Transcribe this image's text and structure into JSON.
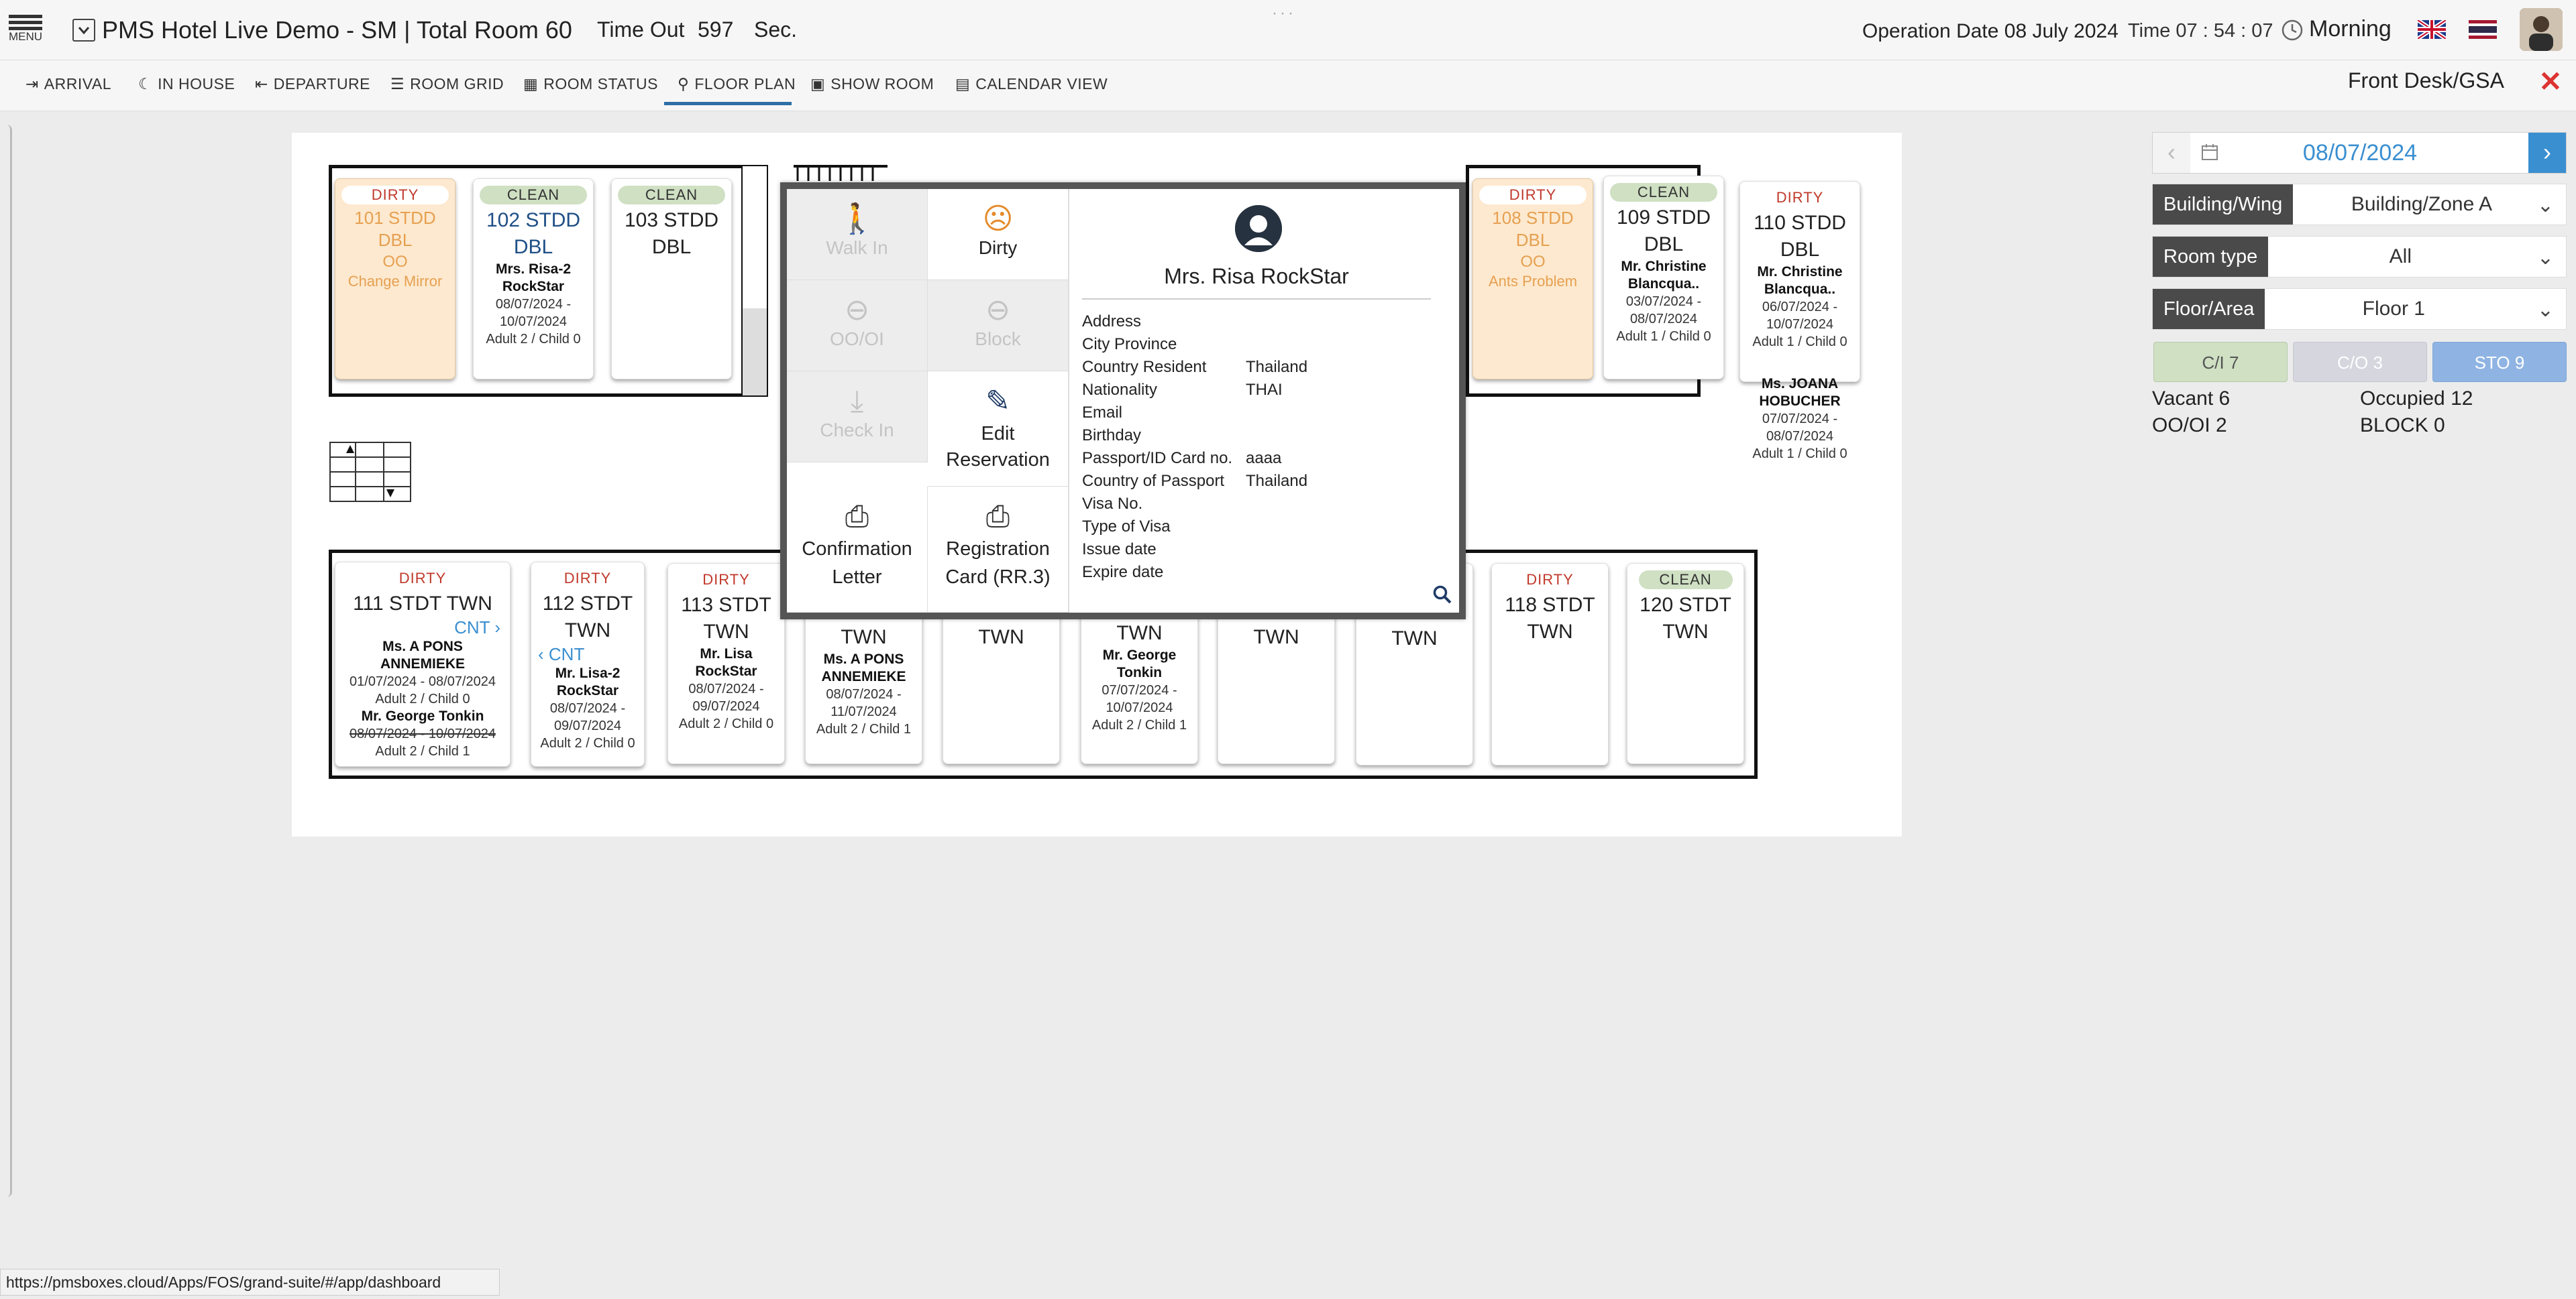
{
  "header": {
    "menu_label": "MENU",
    "hotel_title": "PMS Hotel Live Demo - SM | Total Room 60",
    "timeout_label": "Time Out",
    "timeout_value": "597",
    "timeout_unit": "Sec.",
    "operation_date": "Operation Date 08 July 2024",
    "time_label": "Time 07 : 54 : 07",
    "shift": "Morning"
  },
  "nav": {
    "items": [
      "ARRIVAL",
      "IN HOUSE",
      "DEPARTURE",
      "ROOM GRID",
      "ROOM STATUS",
      "FLOOR PLAN",
      "SHOW ROOM",
      "CALENDAR VIEW"
    ],
    "active": "FLOOR PLAN",
    "role": "Front Desk/GSA"
  },
  "rooms_top": [
    {
      "status": "DIRTY",
      "name": "101 STDD",
      "type": "DBL",
      "oo": "OO",
      "note": "Change Mirror"
    },
    {
      "status": "CLEAN",
      "name": "102 STDD",
      "type": "DBL",
      "guest1": "Mrs. Risa-2",
      "guest2": "RockStar",
      "dates1": "08/07/2024 -",
      "dates2": "10/07/2024",
      "pax": "Adult 2 / Child 0"
    },
    {
      "status": "CLEAN",
      "name": "103 STDD",
      "type": "DBL"
    },
    {
      "status": "DIRTY",
      "name": "108 STDD",
      "type": "DBL",
      "oo": "OO",
      "note": "Ants Problem"
    },
    {
      "status": "CLEAN",
      "name": "109 STDD",
      "type": "DBL",
      "guest1": "Mr. Christine",
      "guest2": "Blancqua..",
      "dates1": "03/07/2024 -",
      "dates2": "08/07/2024",
      "pax": "Adult 1 / Child 0"
    },
    {
      "status": "DIRTY",
      "name": "110 STDD",
      "type": "DBL",
      "guest1": "Mr. Christine",
      "guest2": "Blancqua..",
      "dates1": "06/07/2024 -",
      "dates2": "10/07/2024",
      "pax": "Adult 1 / Child 0",
      "guest3": "Ms. JOANA",
      "guest4": "HOBUCHER",
      "dates3": "07/07/2024 -",
      "dates4": "08/07/2024",
      "pax2": "Adult 1 / Child 0"
    }
  ],
  "rooms_bottom": [
    {
      "status": "DIRTY",
      "name": "111 STDT TWN",
      "cnt": "CNT",
      "guest1": "Ms. A PONS",
      "guest2": "ANNEMIEKE",
      "dates1": "01/07/2024 - 08/07/2024",
      "pax": "Adult 2 / Child 0",
      "guest3": "Mr. George Tonkin",
      "dates2": "08/07/2024 - 10/07/2024",
      "pax2": "Adult 2 / Child 1"
    },
    {
      "status": "DIRTY",
      "name": "112 STDT",
      "type": "TWN",
      "cnt": "CNT",
      "guest1": "Mr. Lisa-2",
      "guest2": "RockStar",
      "dates1": "08/07/2024 -",
      "dates2": "09/07/2024",
      "pax": "Adult 2 / Child 0"
    },
    {
      "status": "DIRTY",
      "name": "113 STDT",
      "type": "TWN",
      "guest1": "Mr. Lisa",
      "guest2": "RockStar",
      "dates1": "08/07/2024 -",
      "dates2": "09/07/2024",
      "pax": "Adult 2 / Child 0"
    },
    {
      "type": "TWN",
      "guest1": "Ms. A PONS",
      "guest2": "ANNEMIEKE",
      "dates1": "08/07/2024 -",
      "dates2": "11/07/2024",
      "pax": "Adult 2 / Child 1"
    },
    {
      "type": "TWN"
    },
    {
      "type": "TWN",
      "guest1": "Mr. George",
      "guest2": "Tonkin",
      "dates1": "07/07/2024 -",
      "dates2": "10/07/2024",
      "pax": "Adult 2 / Child 1"
    },
    {
      "type": "TWN"
    },
    {
      "type": "TWN"
    },
    {
      "status": "DIRTY",
      "name": "118 STDT",
      "type": "TWN"
    },
    {
      "status": "CLEAN",
      "name": "120 STDT",
      "type": "TWN"
    }
  ],
  "popup": {
    "actions": {
      "walk_in": "Walk In",
      "dirty": "Dirty",
      "oooi": "OO/OI",
      "block": "Block",
      "check_in": "Check In",
      "edit_reservation1": "Edit",
      "edit_reservation2": "Reservation",
      "confirmation1": "Confirmation",
      "confirmation2": "Letter",
      "registration1": "Registration",
      "registration2": "Card (RR.3)"
    },
    "guest_name": "Mrs. Risa RockStar",
    "fields": [
      {
        "label": "Address",
        "value": ""
      },
      {
        "label": "City Province",
        "value": ""
      },
      {
        "label": "Country Resident",
        "value": "Thailand"
      },
      {
        "label": "Nationality",
        "value": "THAI"
      },
      {
        "label": "Email",
        "value": ""
      },
      {
        "label": "Birthday",
        "value": ""
      },
      {
        "label": "Passport/ID Card no.",
        "value": "aaaa"
      },
      {
        "label": "Country of Passport",
        "value": "Thailand"
      },
      {
        "label": "Visa No.",
        "value": ""
      },
      {
        "label": "Type of Visa",
        "value": ""
      },
      {
        "label": "Issue date",
        "value": ""
      },
      {
        "label": "Expire date",
        "value": ""
      }
    ]
  },
  "panel": {
    "date": "08/07/2024",
    "building_label": "Building/Wing",
    "building_value": "Building/Zone A",
    "roomtype_label": "Room type",
    "roomtype_value": "All",
    "floor_label": "Floor/Area",
    "floor_value": "Floor 1",
    "tags": [
      "C/I 7",
      "C/O 3",
      "STO 9"
    ],
    "vacant": "Vacant 6",
    "occupied": "Occupied 12",
    "oooi": "OO/OI 2",
    "block": "BLOCK 0"
  },
  "status_url": "https://pmsboxes.cloud/Apps/FOS/grand-suite/#/app/dashboard",
  "colors": {
    "accent": "#3a8fd0",
    "dirty": "#c0392b",
    "clean_badge": "#cfe0c3",
    "oo_orange": "#e6a051"
  }
}
